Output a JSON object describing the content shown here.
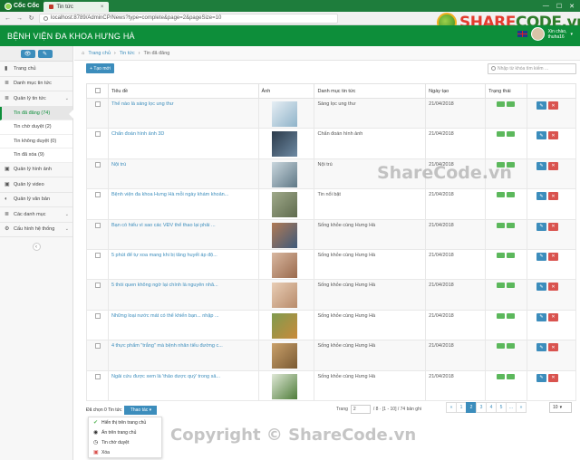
{
  "browser": {
    "brand": "Cốc Cốc",
    "tab_title": "Tin tức",
    "tab_close": "×",
    "url": "localhost:8789/AdminCP/News?type=complete&page=2&pageSize=10",
    "win_min": "—",
    "win_max": "☐",
    "win_close": "✕"
  },
  "logo": {
    "share": "SHARE",
    "code": "CODE",
    "suffix": ".vn"
  },
  "header": {
    "title": "BỆNH VIỆN ĐA KHOA HƯNG HÀ",
    "greeting": "Xin chào,",
    "username": "thuha16",
    "caret": "▾"
  },
  "sidebar": {
    "tool_eye": "👁",
    "tool_pencil": "✎",
    "items": [
      {
        "label": "Trang chủ",
        "icon": "▮"
      },
      {
        "label": "Danh mục tin tức",
        "icon": "≣"
      },
      {
        "label": "Quản lý tin tức",
        "icon": "≣",
        "chev": "⌄"
      }
    ],
    "sub": [
      {
        "label": "Tin đã đăng (74)"
      },
      {
        "label": "Tin chờ duyệt (2)"
      },
      {
        "label": "Tin không duyệt (0)"
      },
      {
        "label": "Tin đã xóa (9)"
      }
    ],
    "items2": [
      {
        "label": "Quản lý hình ảnh",
        "icon": "▣"
      },
      {
        "label": "Quản lý video",
        "icon": "▣"
      },
      {
        "label": "Quản lý văn bản",
        "icon": "◐"
      },
      {
        "label": "Các danh mục",
        "icon": "≣",
        "chev": "⌄"
      },
      {
        "label": "Cấu hình hệ thống",
        "icon": "⚙",
        "chev": "⌄"
      }
    ],
    "collapse": "‹"
  },
  "breadcrumb": {
    "home": "Trang chủ",
    "sep": "›",
    "news": "Tin tức",
    "current": "Tin đã đăng"
  },
  "toolbar": {
    "add_label": "+ Tạo mới",
    "search_placeholder": "Nhập từ khóa tìm kiếm ..."
  },
  "table": {
    "headers": [
      "",
      "Tiêu đề",
      "Ảnh",
      "Danh mục tin tức",
      "Ngày tạo",
      "Trạng thái",
      ""
    ],
    "rows": [
      {
        "title": "Thế nào là sáng lọc ung thư",
        "category": "Sàng lọc ung thư",
        "date": "21/04/2018",
        "img": "doctor"
      },
      {
        "title": "Chẩn đoán hình ảnh 3D",
        "category": "Chẩn đoán hình ảnh",
        "date": "21/04/2018",
        "img": "xray"
      },
      {
        "title": "Nội trú",
        "category": "Nội trú",
        "date": "21/04/2018",
        "img": "ward"
      },
      {
        "title": "Bệnh viện đa khoa Hưng Hà mỗi ngày khám khoản...",
        "category": "Tin nổi bật",
        "date": "21/04/2018",
        "img": "crowd"
      },
      {
        "title": "Bạn có hiểu vì sao các VĐV thể thao lại phải ...",
        "category": "Sống khỏe cùng Hưng Hà",
        "date": "21/04/2018",
        "img": "athlete"
      },
      {
        "title": "5 phút để tự xoa mang khi bị tăng huyết áp độ...",
        "category": "Sống khỏe cùng Hưng Hà",
        "date": "21/04/2018",
        "img": "massage"
      },
      {
        "title": "5 thói quen không ngờ lại chính là nguyên nhâ...",
        "category": "Sống khỏe cùng Hưng Hà",
        "date": "21/04/2018",
        "img": "face"
      },
      {
        "title": "Những loại nước mát có thể khiến bạn... nhập ...",
        "category": "Sống khỏe cùng Hưng Hà",
        "date": "21/04/2018",
        "img": "drinks"
      },
      {
        "title": "4 thực phẩm \"trắng\" mà bệnh nhân tiểu đường c...",
        "category": "Sống khỏe cùng Hưng Hà",
        "date": "21/04/2018",
        "img": "food"
      },
      {
        "title": "Ngải cứu được xem là 'thảo dược quý' trong sả...",
        "category": "Sống khỏe cùng Hưng Hà",
        "date": "21/04/2018",
        "img": "herb"
      }
    ]
  },
  "bulk": {
    "selected_text": "Đã chọn 0 Tin tức",
    "action_label": "Thao tác ▾",
    "menu": [
      {
        "label": "Hiển thị trên trang chủ",
        "icon": "✔"
      },
      {
        "label": "Ẩn trên trang chủ",
        "icon": "◉"
      },
      {
        "label": "Tin chờ duyệt",
        "icon": "◷"
      },
      {
        "label": "Xóa",
        "icon": "▣"
      }
    ]
  },
  "pagination": {
    "label": "Trang",
    "page_value": "2",
    "info": "/ 8 · [1 - 10] / 74 bản ghi",
    "pages": [
      "«",
      "1",
      "2",
      "3",
      "4",
      "5",
      "...",
      "»"
    ],
    "active": "2",
    "size": "10",
    "size_caret": "▾"
  },
  "watermark": {
    "mid": "ShareCode.vn",
    "bottom": "Copyright © ShareCode.vn",
    "link": "ShareCode.vn"
  },
  "colors": {
    "brand_green": "#0d8e3a",
    "primary": "#3c8dbc",
    "danger": "#d9534f",
    "success": "#5cb85c"
  }
}
